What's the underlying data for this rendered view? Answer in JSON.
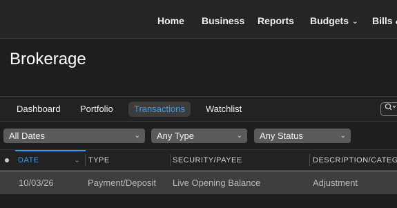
{
  "topnav": {
    "items": [
      "Home",
      "Business",
      "Reports",
      "Budgets",
      "Bills &"
    ]
  },
  "page": {
    "title": "Brokerage"
  },
  "tabs": [
    "Dashboard",
    "Portfolio",
    "Transactions",
    "Watchlist"
  ],
  "active_tab": "Transactions",
  "search": {
    "icon": "search-icon"
  },
  "filters": {
    "dates": "All Dates",
    "type": "Any Type",
    "status": "Any Status"
  },
  "table": {
    "columns": [
      "DATE",
      "TYPE",
      "SECURITY/PAYEE",
      "DESCRIPTION/CATEG"
    ],
    "sorted_by": "DATE",
    "rows": [
      {
        "date": "10/03/26",
        "type": "Payment/Deposit",
        "security": "Live Opening Balance",
        "description": "Adjustment"
      }
    ]
  },
  "colors": {
    "accent": "#3a9cf0",
    "background": "#1e1e1e",
    "row_selected": "#3e3e3e"
  }
}
